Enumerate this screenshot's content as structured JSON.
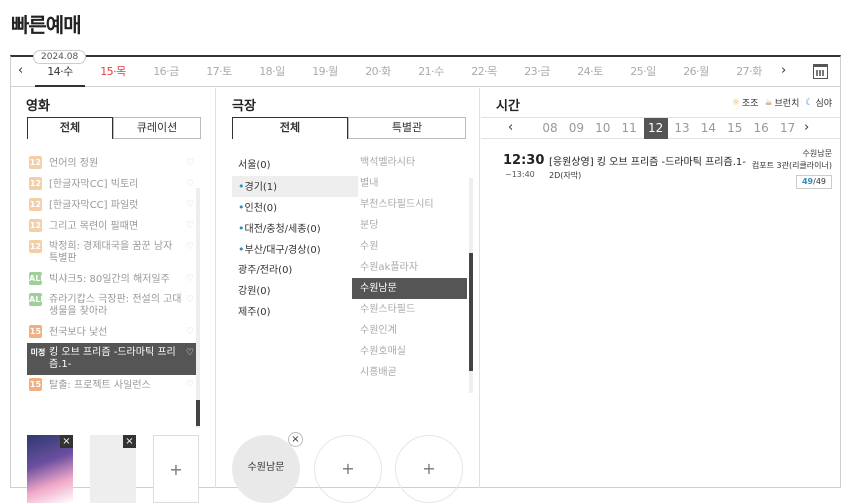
{
  "page_title": "빠른예매",
  "datebar": {
    "year_month": "2024.08",
    "prev": "‹",
    "next": "›",
    "dates": [
      {
        "label": "14·수",
        "state": "selected"
      },
      {
        "label": "15·목",
        "state": "holiday"
      },
      {
        "label": "16·금",
        "state": "normal"
      },
      {
        "label": "17·토",
        "state": "normal"
      },
      {
        "label": "18·일",
        "state": "normal"
      },
      {
        "label": "19·월",
        "state": "normal"
      },
      {
        "label": "20·화",
        "state": "normal"
      },
      {
        "label": "21·수",
        "state": "normal"
      },
      {
        "label": "22·목",
        "state": "normal"
      },
      {
        "label": "23·금",
        "state": "normal"
      },
      {
        "label": "24·토",
        "state": "normal"
      },
      {
        "label": "25·일",
        "state": "normal"
      },
      {
        "label": "26·월",
        "state": "normal"
      },
      {
        "label": "27·화",
        "state": "normal"
      }
    ],
    "calendar_icon": "calendar-icon"
  },
  "movie": {
    "heading": "영화",
    "tabs": [
      "전체",
      "큐레이션"
    ],
    "items": [
      {
        "age": "12",
        "title": "언어의 정원"
      },
      {
        "age": "12",
        "title": "[한글자막CC] 빅토리"
      },
      {
        "age": "12",
        "title": "[한글자막CC] 파일럿"
      },
      {
        "age": "12",
        "title": "그리고 목련이 필때면"
      },
      {
        "age": "12",
        "title": "박정희: 경제대국을 꿈꾼 남자 특별판"
      },
      {
        "age": "ALL",
        "title": "빅샤크5: 80일간의 해저일주"
      },
      {
        "age": "ALL",
        "title": "쥬라기캅스 극장판: 전설의 고대 생물을 찾아라"
      },
      {
        "age": "15",
        "title": "천국보다 낯선"
      },
      {
        "age": "미정",
        "title": "킹 오브 프리즘 -드라마틱 프리즘.1-",
        "selected": true
      },
      {
        "age": "15",
        "title": "탈출: 프로젝트 사일런스"
      }
    ],
    "heart": "♡",
    "picks": {
      "close": "×",
      "add": "+"
    }
  },
  "theater": {
    "heading": "극장",
    "tabs": [
      "전체",
      "특별관"
    ],
    "regions": [
      {
        "label": "서울(0)",
        "dot": false
      },
      {
        "label": "경기(1)",
        "dot": true,
        "selected": true
      },
      {
        "label": "인천(0)",
        "dot": true
      },
      {
        "label": "대전/충청/세종(0)",
        "dot": true
      },
      {
        "label": "부산/대구/경상(0)",
        "dot": true
      },
      {
        "label": "광주/전라(0)",
        "dot": false
      },
      {
        "label": "강원(0)",
        "dot": false
      },
      {
        "label": "제주(0)",
        "dot": false
      }
    ],
    "theaters": [
      "백석벨라시타",
      "별내",
      "부천스타필드시티",
      "분당",
      "수원",
      "수원ak플라자",
      "수원남문",
      "수원스타필드",
      "수원인계",
      "수원호매실",
      "시흥배곧"
    ],
    "selected_theater": "수원남문",
    "picks": {
      "selected": "수원남문",
      "close": "×",
      "add": "+"
    }
  },
  "time": {
    "heading": "시간",
    "legend": [
      {
        "icon": "sun-icon",
        "glyph": "☼",
        "label": "조조"
      },
      {
        "icon": "brunch-icon",
        "glyph": "☕",
        "label": "브런치"
      },
      {
        "icon": "moon-icon",
        "glyph": "☾",
        "label": "심야"
      }
    ],
    "hours": [
      "08",
      "09",
      "10",
      "11",
      "12",
      "13",
      "14",
      "15",
      "16",
      "17"
    ],
    "selected_hour": "12",
    "show": {
      "start": "12:30",
      "end": "~13:40",
      "title": "[응원상영] 킹 오브 프리즘 -드라마틱 프리즘.1-",
      "format": "2D(자막)",
      "theater": "수원남문",
      "screen": "컴포트 3관(리클라이너)",
      "seats_left": "49",
      "seats_total": "/49"
    }
  }
}
